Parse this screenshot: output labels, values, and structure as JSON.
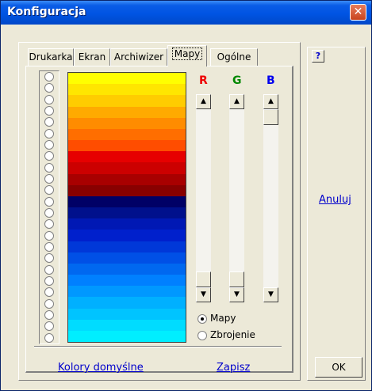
{
  "window": {
    "title": "Konfiguracja",
    "close_glyph": "✕"
  },
  "tabs": [
    "Drukarka",
    "Ekran",
    "Archiwizer",
    "Mapy",
    "Ogólne"
  ],
  "active_tab": "Mapy",
  "channels": {
    "r_label": "R",
    "g_label": "G",
    "b_label": "B",
    "r_color": "#ee0000",
    "g_color": "#008800",
    "b_color": "#0000ee"
  },
  "palette_colors": [
    "#ffff00",
    "#ffe600",
    "#ffcc00",
    "#ffaa00",
    "#ff8c00",
    "#ff6e00",
    "#ff4d00",
    "#e60000",
    "#cc0000",
    "#a80000",
    "#880000",
    "#000066",
    "#00108c",
    "#0018b4",
    "#0020cc",
    "#0038d8",
    "#0050e6",
    "#0068f0",
    "#0080ff",
    "#0098ff",
    "#00b0ff",
    "#00c4ff",
    "#00dcff",
    "#00eeff"
  ],
  "scroll_values": {
    "r": 1.0,
    "g": 1.0,
    "b": 0.0
  },
  "map_type_options": [
    {
      "label": "Mapy",
      "selected": true
    },
    {
      "label": "Zbrojenie",
      "selected": false
    }
  ],
  "links": {
    "default_colors": "Kolory domyślne",
    "save": "Zapisz",
    "cancel": "Anuluj"
  },
  "buttons": {
    "help": "?",
    "ok": "OK"
  },
  "icons": {
    "scroll_up": "▲",
    "scroll_down": "▼"
  }
}
